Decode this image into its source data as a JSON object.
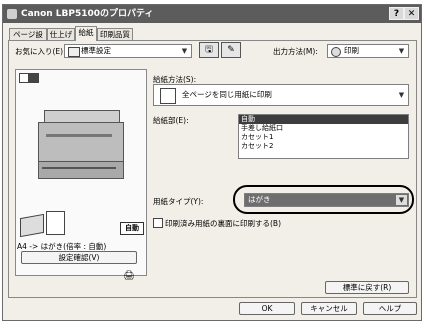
{
  "window": {
    "title": "Canon LBP5100のプロパティ",
    "help_label": "?",
    "close_label": "✕"
  },
  "tabs": [
    {
      "label": "ページ設定"
    },
    {
      "label": "仕上げ"
    },
    {
      "label": "給紙"
    },
    {
      "label": "印刷品質"
    }
  ],
  "toolbar": {
    "favorites_label": "お気に入り(E):",
    "favorites_value": "標準設定",
    "output_label": "出力方法(M):",
    "output_value": "印刷"
  },
  "preview": {
    "auto_badge": "自動",
    "summary": "A4 -> はがき(倍率 : 自動)",
    "confirm_button": "設定確認(V)"
  },
  "feed": {
    "method_label": "給紙方法(S):",
    "method_value": "全ページを同じ用紙に印刷",
    "source_label": "給紙部(E):",
    "source_items": [
      "自動",
      "手差し給紙口",
      "カセット1",
      "カセット2"
    ],
    "source_selected": 0,
    "paper_type_label": "用紙タイプ(Y):",
    "paper_type_value": "はがき",
    "back_print_label": "印刷済み用紙の裏面に印刷する(B)",
    "back_print_checked": false
  },
  "buttons": {
    "restore": "標準に戻す(R)",
    "ok": "OK",
    "cancel": "キャンセル",
    "help": "ヘルプ"
  },
  "colors": {
    "titlebar": "#5c5c5c",
    "selection": "#3d3d3d",
    "highlight_ring": "#000000"
  }
}
